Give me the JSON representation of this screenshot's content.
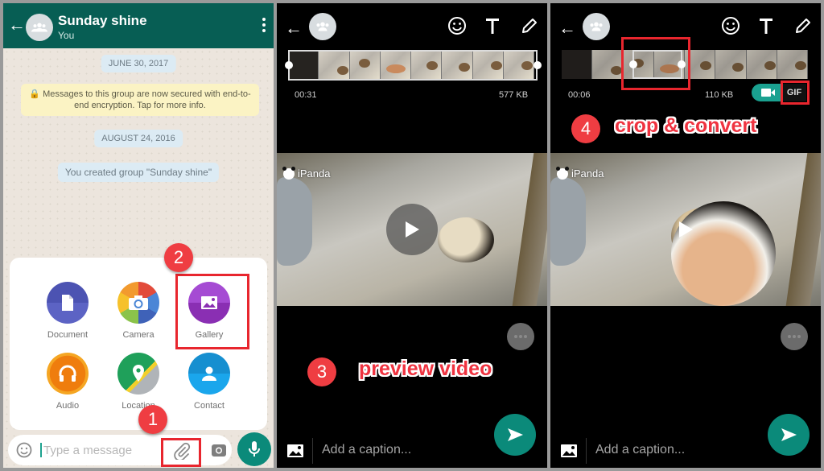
{
  "panel1": {
    "header": {
      "title": "Sunday shine",
      "subtitle": "You",
      "back_icon": "arrow-left-icon",
      "menu_icon": "more-vertical-icon"
    },
    "messages": {
      "date_chip_1": "JUNE 30, 2017",
      "encryption_notice": "Messages to this group are now secured with end-to-end encryption. Tap for more info.",
      "date_chip_2": "AUGUST 24, 2016",
      "system_message": "You created group \"Sunday shine\""
    },
    "attach_menu": {
      "items": [
        {
          "label": "Document",
          "icon": "document-icon",
          "color": "#5c63c4"
        },
        {
          "label": "Camera",
          "icon": "camera-icon",
          "color": "#e8a53a"
        },
        {
          "label": "Gallery",
          "icon": "gallery-icon",
          "color": "#9b35c9"
        },
        {
          "label": "Audio",
          "icon": "headphones-icon",
          "color": "#f08a12"
        },
        {
          "label": "Location",
          "icon": "location-icon",
          "color": "#1fa05a"
        },
        {
          "label": "Contact",
          "icon": "contact-icon",
          "color": "#1a9fe3"
        }
      ]
    },
    "input": {
      "placeholder": "Type a message",
      "emoji_icon": "emoji-icon",
      "attach_icon": "paperclip-icon",
      "camera_icon": "camera-icon",
      "mic_icon": "mic-icon"
    }
  },
  "panel2": {
    "duration": "00:31",
    "size": "577 KB",
    "watermark": "iPanda",
    "caption_placeholder": "Add a caption...",
    "toolbar_icons": [
      "emoji-icon",
      "text-icon",
      "pencil-icon"
    ]
  },
  "panel3": {
    "duration": "00:06",
    "size": "110 KB",
    "gif_label": "GIF",
    "watermark": "iPanda",
    "caption_placeholder": "Add a caption...",
    "toolbar_icons": [
      "emoji-icon",
      "text-icon",
      "pencil-icon"
    ]
  },
  "annotations": {
    "step1": "1",
    "step2": "2",
    "step3": "3",
    "step3_text": "preview video",
    "step4": "4",
    "step4_text": "crop & convert",
    "accent_color": "#ef3d42"
  },
  "colors": {
    "whatsapp_header": "#075e54",
    "whatsapp_green": "#0b8a7a"
  }
}
